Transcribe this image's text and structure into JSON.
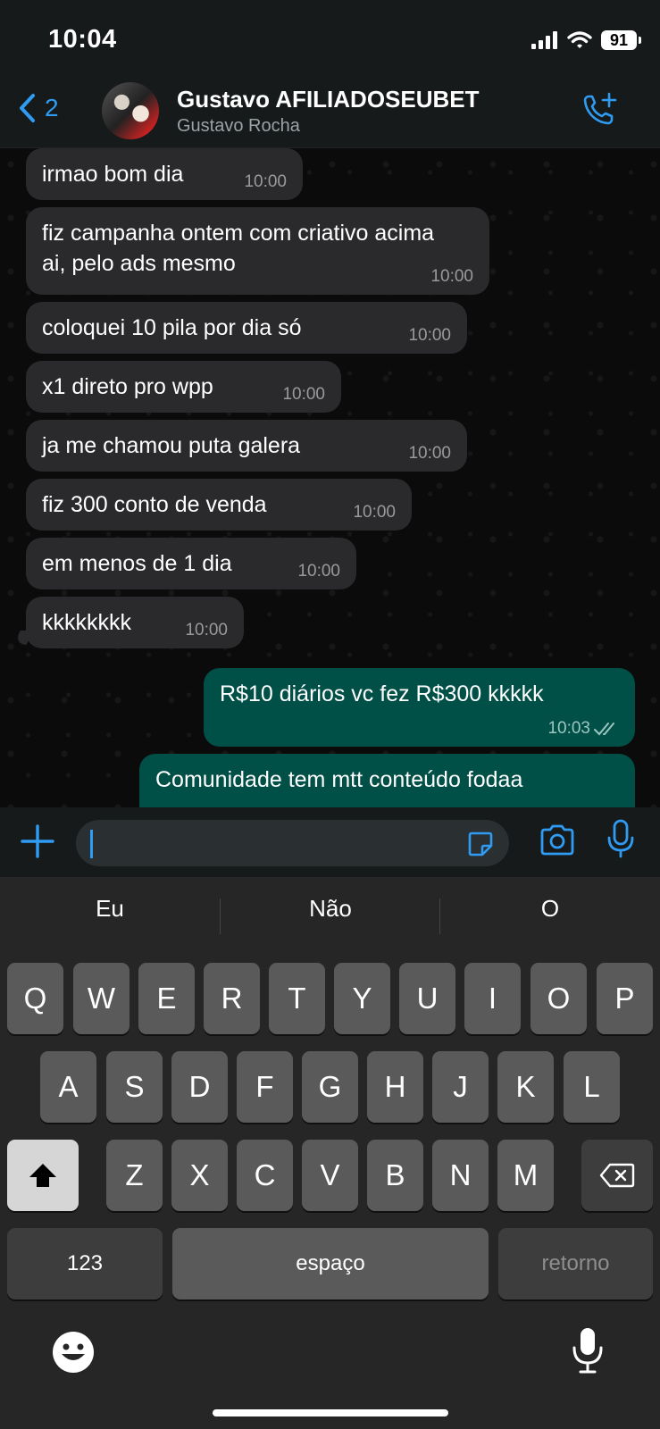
{
  "status": {
    "time": "10:04",
    "battery": "91"
  },
  "header": {
    "back_count": "2",
    "title": "Gustavo AFILIADOSEUBET",
    "subtitle": "Gustavo Rocha"
  },
  "messages": [
    {
      "text": "irmao bom dia",
      "time": "10:00",
      "direction": "in"
    },
    {
      "text": "fiz campanha ontem com criativo acima ai, pelo ads mesmo",
      "time": "10:00",
      "direction": "in"
    },
    {
      "text": "coloquei 10 pila por dia só",
      "time": "10:00",
      "direction": "in"
    },
    {
      "text": "x1 direto pro wpp",
      "time": "10:00",
      "direction": "in"
    },
    {
      "text": "ja me chamou puta galera",
      "time": "10:00",
      "direction": "in"
    },
    {
      "text": "fiz 300 conto de venda",
      "time": "10:00",
      "direction": "in"
    },
    {
      "text": "em menos de 1 dia",
      "time": "10:00",
      "direction": "in"
    },
    {
      "text": "kkkkkkkk",
      "time": "10:00",
      "direction": "in"
    },
    {
      "text": "R$10 diários vc fez R$300 kkkkk",
      "time": "10:03",
      "direction": "out",
      "read": true
    },
    {
      "text": "Comunidade tem mtt conteúdo fodaa",
      "time": "",
      "direction": "out"
    }
  ],
  "composer": {
    "value": ""
  },
  "keyboard": {
    "suggestions": [
      "Eu",
      "Não",
      "O"
    ],
    "row1": [
      "Q",
      "W",
      "E",
      "R",
      "T",
      "Y",
      "U",
      "I",
      "O",
      "P"
    ],
    "row2": [
      "A",
      "S",
      "D",
      "F",
      "G",
      "H",
      "J",
      "K",
      "L"
    ],
    "row3": [
      "Z",
      "X",
      "C",
      "V",
      "B",
      "N",
      "M"
    ],
    "numbers_key": "123",
    "space_key": "espaço",
    "return_key": "retorno"
  },
  "colors": {
    "accent": "#2f9bf2",
    "incoming_bubble": "#2a2a2c",
    "outgoing_bubble": "#005048"
  }
}
